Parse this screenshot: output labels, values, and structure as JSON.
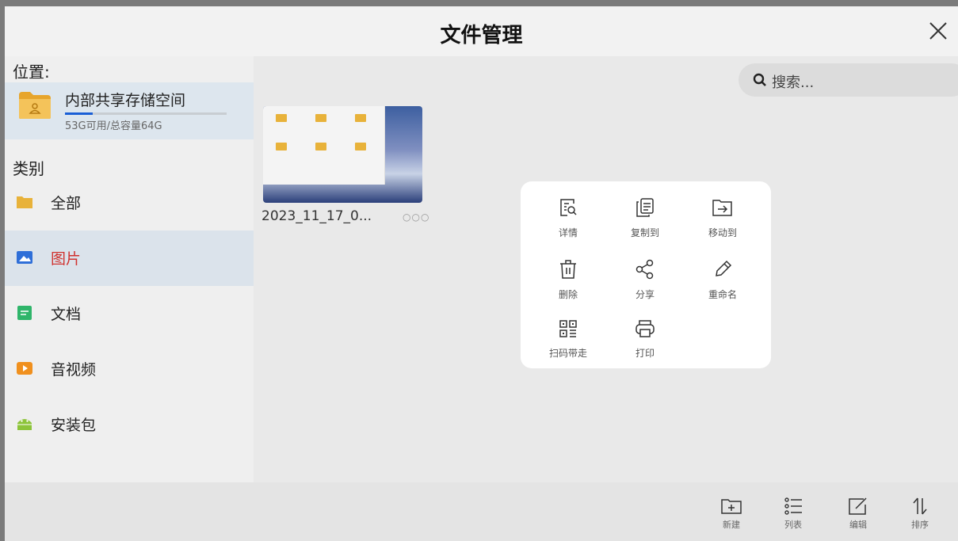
{
  "window": {
    "title": "文件管理"
  },
  "sidebar": {
    "location_label": "位置:",
    "storage": {
      "name": "内部共享存储空间",
      "detail": "53G可用/总容量64G",
      "usage_fraction": 0.17
    },
    "category_label": "类别",
    "categories": [
      {
        "label": "全部",
        "icon": "folder-icon",
        "color": "#e8b23a"
      },
      {
        "label": "图片",
        "icon": "image-icon",
        "color": "#2f6fd8",
        "active": true
      },
      {
        "label": "文档",
        "icon": "document-icon",
        "color": "#2fb56a"
      },
      {
        "label": "音视频",
        "icon": "video-icon",
        "color": "#f0901e"
      },
      {
        "label": "安装包",
        "icon": "android-icon",
        "color": "#8cc43a"
      }
    ]
  },
  "search": {
    "placeholder": "搜索..."
  },
  "files": [
    {
      "name": "2023_11_17_0...",
      "more": "○○○"
    }
  ],
  "context_menu": {
    "items": [
      {
        "label": "详情",
        "icon": "details-icon"
      },
      {
        "label": "复制到",
        "icon": "copy-to-icon"
      },
      {
        "label": "移动到",
        "icon": "move-to-icon"
      },
      {
        "label": "删除",
        "icon": "delete-icon"
      },
      {
        "label": "分享",
        "icon": "share-icon"
      },
      {
        "label": "重命名",
        "icon": "rename-icon"
      },
      {
        "label": "扫码带走",
        "icon": "qr-code-icon"
      },
      {
        "label": "打印",
        "icon": "print-icon"
      }
    ]
  },
  "toolbar": {
    "new": "新建",
    "list": "列表",
    "edit": "编辑",
    "sort": "排序"
  },
  "colors": {
    "accent": "#1a5fd6",
    "active_text": "#d0322f"
  }
}
